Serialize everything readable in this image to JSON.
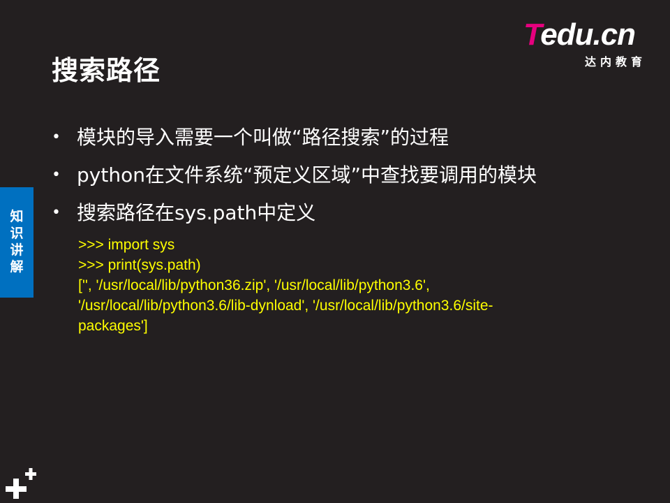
{
  "slide": {
    "title": "搜索路径",
    "logo": {
      "brand_t": "T",
      "brand_rest": "edu.cn",
      "subtitle": "达内教育"
    },
    "side_tab": {
      "label": "知\n识\n讲\n解"
    },
    "bullets": [
      {
        "text": "模块的导入需要一个叫做“路径搜索”的过程"
      },
      {
        "text": "python在文件系统“预定义区域”中查找要调用的模块"
      },
      {
        "text": "搜索路径在sys.path中定义"
      }
    ],
    "code": {
      "line1": ">>> import sys",
      "line2": ">>> print(sys.path)",
      "line3": "['', '/usr/local/lib/python36.zip', '/usr/local/lib/python3.6',",
      "line4": "'/usr/local/lib/python3.6/lib-dynload', '/usr/local/lib/python3.6/site-",
      "line5": "packages']"
    },
    "colors": {
      "background": "#231f20",
      "code_text": "#ffff00",
      "side_tab": "#0070c0",
      "logo_accent": "#e6007e"
    },
    "icons": {
      "bottom_left": "plus-icon"
    }
  }
}
